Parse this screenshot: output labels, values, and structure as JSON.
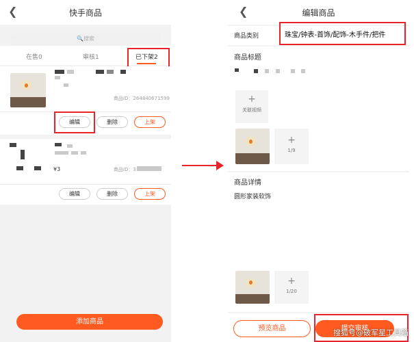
{
  "left": {
    "header": {
      "back_icon": "chevron-left-icon",
      "title": "快手商品"
    },
    "search": {
      "placeholder": "🔍搜索"
    },
    "tabs": [
      {
        "label": "在售0"
      },
      {
        "label": "审核1"
      },
      {
        "label": "已下架2",
        "active": true
      }
    ],
    "products": [
      {
        "id_text": "商品ID：264840671599",
        "actions": [
          "编辑",
          "删除",
          "上架"
        ]
      },
      {
        "price": "¥3",
        "id_text": "商品ID：3",
        "actions": [
          "编辑",
          "删除",
          "上架"
        ]
      }
    ],
    "add_button": "添加商品"
  },
  "right": {
    "header": {
      "back_icon": "chevron-left-icon",
      "title": "编辑商品"
    },
    "category": {
      "label": "商品类别",
      "value": "珠宝/钟表-首饰/配饰-木手件/把件"
    },
    "title_section": {
      "label": "商品标题"
    },
    "video": {
      "label": "关联视频"
    },
    "images": {
      "count": "1/9"
    },
    "detail": {
      "label": "商品详情",
      "text": "圆形家装软饰",
      "count": "1/20"
    },
    "buttons": {
      "preview": "预览商品",
      "submit": "提交审核"
    }
  },
  "watermark": "搜狐号@破军星工具箱",
  "colors": {
    "accent": "#ff5a1f",
    "highlight": "#e8232a"
  }
}
